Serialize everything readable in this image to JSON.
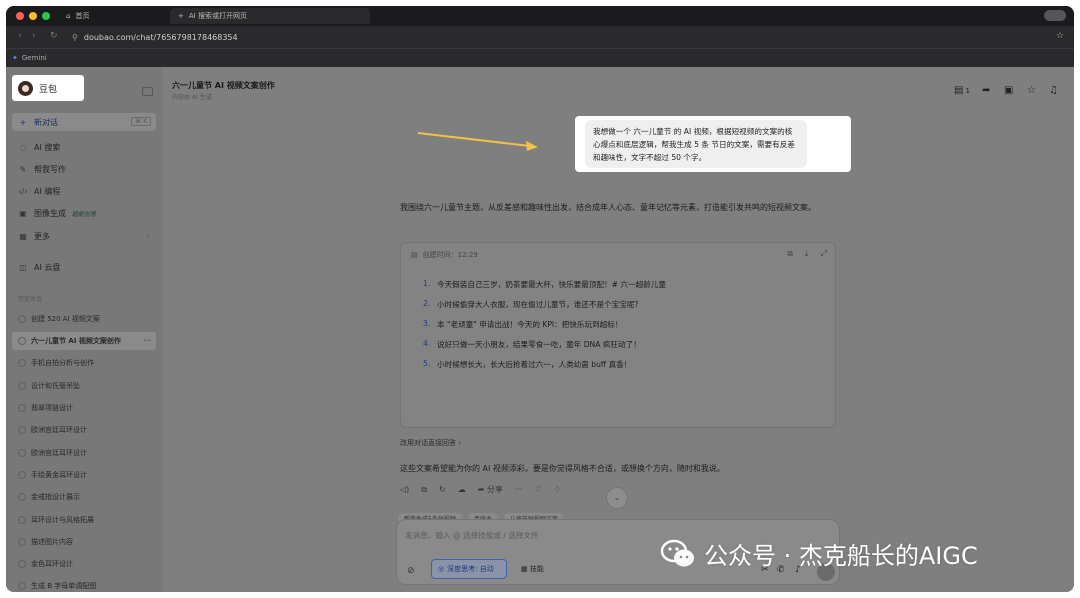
{
  "browser": {
    "tabs": [
      {
        "label": "首页",
        "active": false
      },
      {
        "label": "AI 搜索或打开网页",
        "active": true
      }
    ],
    "url": "doubao.com/chat/7656798178468354",
    "bookmark": "Gemini",
    "traffic_lights": [
      "#ff5f57",
      "#febc2e",
      "#28c840"
    ]
  },
  "sidebar": {
    "brand": "豆包",
    "items": [
      {
        "label": "新对话",
        "icon": "plus-icon",
        "shortcut": "⌘ K"
      },
      {
        "label": "AI 搜索",
        "icon": "search-icon"
      },
      {
        "label": "帮我写作",
        "icon": "pen-icon"
      },
      {
        "label": "AI 编程",
        "icon": "code-icon"
      },
      {
        "label": "图像生成",
        "icon": "image-icon",
        "badge": "超能创意"
      },
      {
        "label": "更多",
        "icon": "grid-icon"
      },
      {
        "label": "AI 云盘",
        "icon": "cloud-drive-icon"
      }
    ],
    "history_label": "历史对话",
    "history": [
      "创建 520 AI 视频文案",
      "六一儿童节 AI 视频文案创作",
      "手机自拍分析与创作",
      "设计和氏璧吊坠",
      "翡翠项链设计",
      "欧洲宫廷耳环设计",
      "欧洲宫廷耳环设计",
      "手绘黄金耳环设计",
      "金戒指设计展示",
      "耳环设计与风格拓展",
      "描述图片内容",
      "金色耳环设计",
      "生成 B 字母单调配图"
    ]
  },
  "header": {
    "title": "六一儿童节 AI 视频文案创作",
    "subtitle": "内容由 AI 生成",
    "doc_count": "1"
  },
  "chat": {
    "user_message": "我想做一个 六一儿童节 的 AI 视频，根据短视频的文案的核心爆点和底层逻辑，帮我生成 5 条 节日的文案，需要有反差和趣味性，文字不超过 50 个字。",
    "response_intro": "我围绕六一儿童节主题，从反差感和趣味性出发，结合成年人心态、童年记忆等元素，打造能引发共鸣的短视频文案。",
    "card_meta": "创建时间：12:29",
    "items": [
      "今天假装自己三岁，奶茶要最大杯，快乐要最顶配！# 六一超龄儿童",
      "小时候偷穿大人衣服，现在偷过儿童节，谁还不是个宝宝呢?",
      "本 \"老顽童\" 申请出战！今天的 KPI：把快乐玩到超标！",
      "说好只做一天小朋友，结果零食一吃，童年 DNA 疯狂动了！",
      "小时候想长大，长大后抢着过六一，人类幼崽 buff 真香！"
    ],
    "suggest": "改用对话直接回答",
    "closing": "这些文案希望能为你的 AI 视频添彩。要是你觉得风格不合适，或想换个方向，随时和我说。",
    "share_label": "分享",
    "chips": [
      "帮我生成5条短视频",
      "老班主",
      "儿童节短视频文案"
    ]
  },
  "composer": {
    "placeholder": "发消息、输入 @ 选择技能或 / 选择文件",
    "deep_think": "深度思考: 自动",
    "skills": "技能"
  },
  "watermark": {
    "text": "公众号 · 杰克船长的AIGC"
  }
}
